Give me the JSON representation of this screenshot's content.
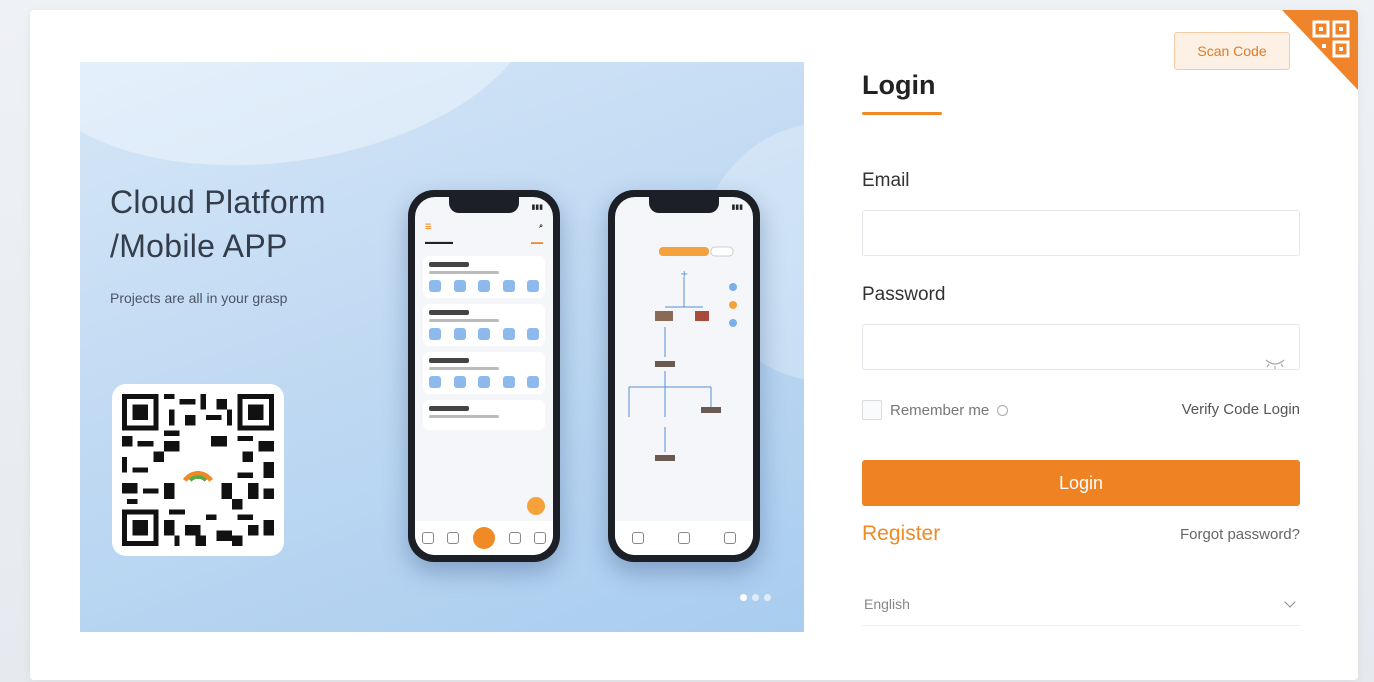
{
  "banner": {
    "heading_line1": "Cloud Platform",
    "heading_line2": "/Mobile APP",
    "subtitle": "Projects are all in your grasp",
    "carousel_dots": 3,
    "active_dot": 0
  },
  "form": {
    "title": "Login",
    "email_label": "Email",
    "email_value": "",
    "password_label": "Password",
    "password_value": "",
    "remember_label": "Remember me",
    "verify_link": "Verify Code Login",
    "login_button": "Login",
    "register_link": "Register",
    "forgot_link": "Forgot password?",
    "language": "English"
  },
  "scan": {
    "label": "Scan Code"
  },
  "colors": {
    "accent": "#ef8222",
    "scan_bg": "#fdf0e4",
    "banner_bg": "#c3dbf3"
  },
  "icons": [
    "qr-code-icon",
    "eye-hidden-icon",
    "info-icon",
    "chevron-down-icon",
    "qr-corner-icon"
  ]
}
